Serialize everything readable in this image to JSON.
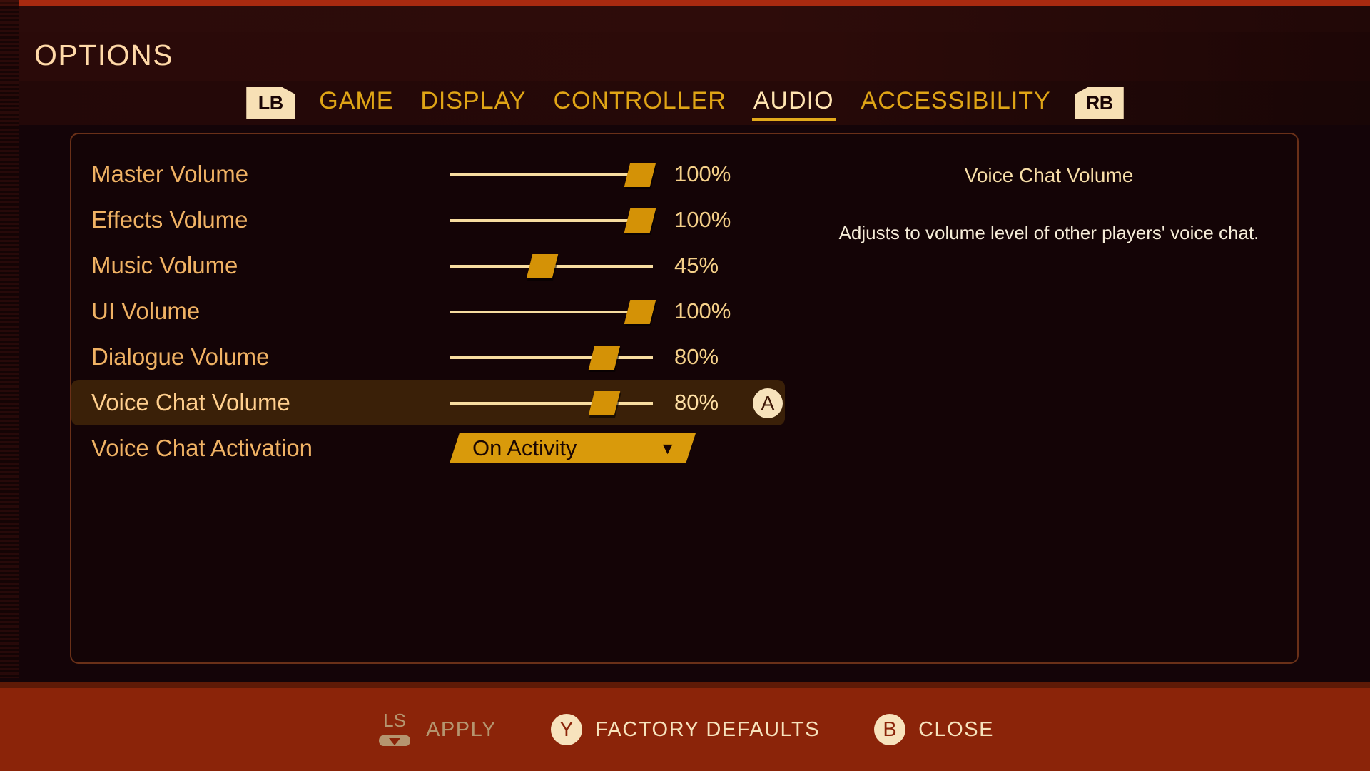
{
  "header": {
    "title": "OPTIONS"
  },
  "tabs": {
    "left_bumper": "LB",
    "right_bumper": "RB",
    "items": [
      {
        "label": "GAME",
        "active": false
      },
      {
        "label": "DISPLAY",
        "active": false
      },
      {
        "label": "CONTROLLER",
        "active": false
      },
      {
        "label": "AUDIO",
        "active": true
      },
      {
        "label": "ACCESSIBILITY",
        "active": false
      }
    ]
  },
  "options": [
    {
      "label": "Master Volume",
      "type": "slider",
      "value": "100%",
      "percent": 100,
      "selected": false
    },
    {
      "label": "Effects Volume",
      "type": "slider",
      "value": "100%",
      "percent": 100,
      "selected": false
    },
    {
      "label": "Music Volume",
      "type": "slider",
      "value": "45%",
      "percent": 45,
      "selected": false
    },
    {
      "label": "UI Volume",
      "type": "slider",
      "value": "100%",
      "percent": 100,
      "selected": false
    },
    {
      "label": "Dialogue Volume",
      "type": "slider",
      "value": "80%",
      "percent": 80,
      "selected": false
    },
    {
      "label": "Voice Chat Volume",
      "type": "slider",
      "value": "80%",
      "percent": 80,
      "selected": true,
      "action_badge": "A"
    },
    {
      "label": "Voice Chat Activation",
      "type": "dropdown",
      "value": "On Activity",
      "arrow": "▼",
      "selected": false
    }
  ],
  "description": {
    "title": "Voice Chat Volume",
    "body": "Adjusts to volume level of other players' voice chat."
  },
  "footer": {
    "prompts": [
      {
        "icon": "left-stick",
        "icon_label": "LS",
        "label": "APPLY",
        "disabled": true
      },
      {
        "icon": "button-y",
        "icon_label": "Y",
        "label": "FACTORY DEFAULTS",
        "disabled": false
      },
      {
        "icon": "button-b",
        "icon_label": "B",
        "label": "CLOSE",
        "disabled": false
      }
    ]
  },
  "colors": {
    "background": "#140408",
    "accent_gold": "#d99a0b",
    "label_orange": "#f0b264",
    "cream": "#f7e3bd",
    "footer_red": "#8b2409",
    "panel_border": "#6a3018",
    "selected_row": "#3a2008"
  }
}
